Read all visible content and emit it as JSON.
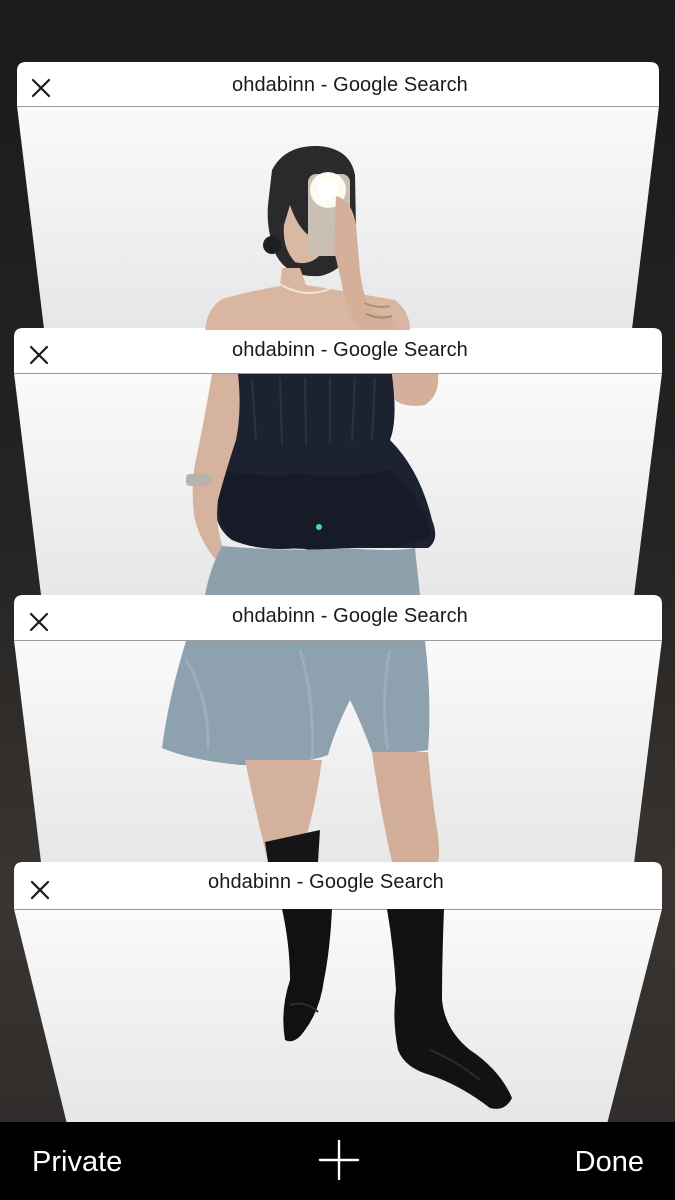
{
  "tabs": [
    {
      "title": "ohdabinn - Google Search"
    },
    {
      "title": "ohdabinn - Google Search"
    },
    {
      "title": "ohdabinn - Google Search"
    },
    {
      "title": "ohdabinn - Google Search"
    }
  ],
  "toolbar": {
    "private_label": "Private",
    "done_label": "Done"
  },
  "icons": {
    "close": "close-icon",
    "add": "plus-icon"
  }
}
